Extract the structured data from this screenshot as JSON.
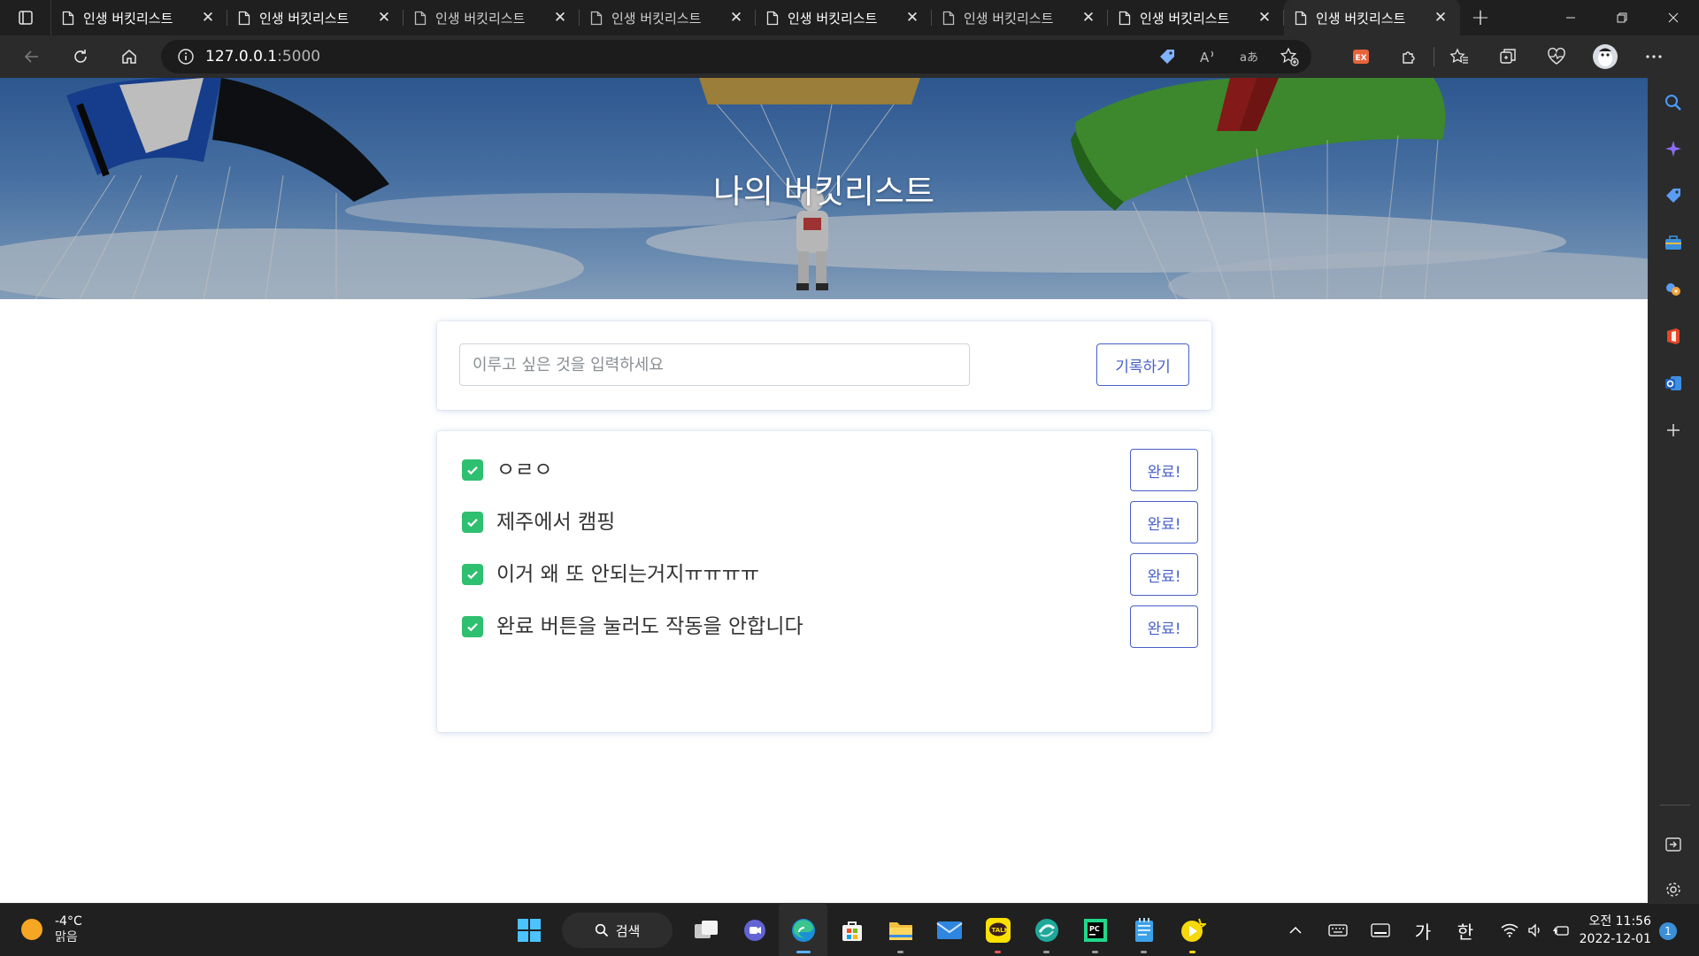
{
  "browser": {
    "tabs": [
      {
        "title": "인생 버킷리스트",
        "active": false
      },
      {
        "title": "인생 버킷리스트",
        "active": false
      },
      {
        "title": "인생 버킷리스트",
        "active": false
      },
      {
        "title": "인생 버킷리스트",
        "active": false
      },
      {
        "title": "인생 버킷리스트",
        "active": false
      },
      {
        "title": "인생 버킷리스트",
        "active": false
      },
      {
        "title": "인생 버킷리스트",
        "active": false
      },
      {
        "title": "인생 버킷리스트",
        "active": true
      }
    ],
    "close_glyph": "✕",
    "new_tab_glyph": "+",
    "address": {
      "host": "127.0.0.1",
      "port": ":5000"
    }
  },
  "page": {
    "hero_title": "나의 버킷리스트",
    "input_placeholder": "이루고 싶은 것을 입력하세요",
    "input_value": "",
    "record_button": "기록하기",
    "items": [
      {
        "text": "ㅇㄹㅇ",
        "done_label": "완료!",
        "checked": true
      },
      {
        "text": "제주에서 캠핑",
        "done_label": "완료!",
        "checked": true
      },
      {
        "text": "이거 왜 또 안되는거지ㅠㅠㅠㅠ",
        "done_label": "완료!",
        "checked": true
      },
      {
        "text": "완료 버튼을 눌러도 작동을 안합니다",
        "done_label": "완료!",
        "checked": true
      }
    ]
  },
  "colors": {
    "accent": "#485fc7",
    "check_green": "#2fbf71",
    "chrome_dark": "#202020"
  },
  "taskbar": {
    "weather_temp": "-4°C",
    "weather_desc": "맑음",
    "search_label": "검색",
    "ime_mode": "가",
    "ime_lang": "한",
    "clock_time": "오전 11:56",
    "clock_date": "2022-12-01",
    "notification_count": "1"
  }
}
